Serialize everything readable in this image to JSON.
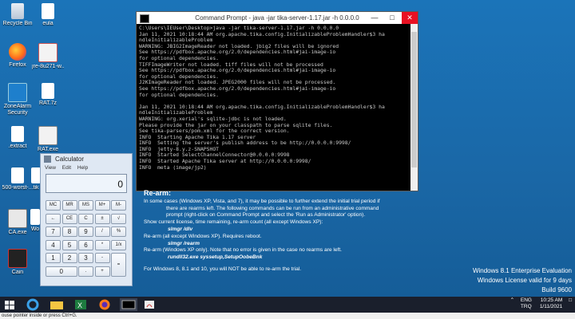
{
  "desktop_icons": [
    {
      "label": "Recycle Bin",
      "icon": "recycle-bin-icon"
    },
    {
      "label": "eula",
      "icon": "document-icon"
    },
    {
      "label": "Firefox",
      "icon": "firefox-icon"
    },
    {
      "label": "jre-8u271-w...",
      "icon": "java-installer-icon"
    },
    {
      "label": "ZoneAlarm Security",
      "icon": "zonealarm-icon"
    },
    {
      "label": "RAT.7z",
      "icon": "archive-icon"
    },
    {
      "label": ".extract",
      "icon": "folder-icon"
    },
    {
      "label": "RAT.exe",
      "icon": "exe-icon"
    },
    {
      "label": "500-worst-...",
      "icon": "document-icon"
    },
    {
      "label": "tik",
      "icon": "document-icon"
    },
    {
      "label": "CA.exe",
      "icon": "exe-icon"
    },
    {
      "label": "Wo",
      "icon": "document-icon"
    },
    {
      "label": "Cain",
      "icon": "cain-icon"
    }
  ],
  "cmd": {
    "title": "Command Prompt - java  -jar tika-server-1.17.jar -h 0.0.0.0",
    "lines": [
      "C:\\Users\\IEUser\\Desktop>java -jar tika-server-1.17.jar -h 0.0.0.0",
      "Jan 11, 2021 10:18:44 AM org.apache.tika.config.InitializableProblemHandler$3 ha",
      "ndleInitializableProblem",
      "WARNING: JBIG2ImageReader not loaded. jbig2 files will be ignored",
      "See https://pdfbox.apache.org/2.0/dependencies.html#jai-image-io",
      "for optional dependencies.",
      "TIFFImageWriter not loaded. tiff files will not be processed",
      "See https://pdfbox.apache.org/2.0/dependencies.html#jai-image-io",
      "for optional dependencies.",
      "J2KImageReader not loaded. JPEG2000 files will not be processed.",
      "See https://pdfbox.apache.org/2.0/dependencies.html#jai-image-io",
      "for optional dependencies.",
      "",
      "Jan 11, 2021 10:18:44 AM org.apache.tika.config.InitializableProblemHandler$3 ha",
      "ndleInitializableProblem",
      "WARNING: org.xerial's sqlite-jdbc is not loaded.",
      "Please provide the jar on your classpath to parse sqlite files.",
      "See tika-parsers/pom.xml for the correct version.",
      "INFO  Starting Apache Tika 1.17 server",
      "INFO  Setting the server's publish address to be http://0.0.0.0:9998/",
      "INFO  jetty-8.y.z-SNAPSHOT",
      "INFO  Started SelectChannelConnector@0.0.0.0:9998",
      "INFO  Started Apache Tika server at http://0.0.0.0:9998/",
      "INFO  meta (image/jp2)"
    ]
  },
  "page": {
    "heading": "Re-arm:",
    "p1a": "In some cases (Windows XP, Vista, and 7), it may be possible to further extend the initial trial period if",
    "p1b": "there are rearms left. The following commands can be run from an administrative command",
    "p1c": "prompt (right-click on Command Prompt and select the 'Run as Administrator' option).",
    "p2": "Show current license, time remaining, re-arm count (all except Windows XP):",
    "c1": "slmgr /dlv",
    "p3": "Re-arm (all except Windows XP). Requires reboot.",
    "c2": "slmgr /rearm",
    "p4": "Re-arm (Windows XP only). Note that no error is given in the case no rearms are left.",
    "c3": "rundll32.exe syssetup,SetupOobeBnk",
    "p5": "For Windows 8, 8.1 and 10, you will NOT be able to re-arm the trial."
  },
  "calculator": {
    "title": "Calculator",
    "menu": [
      "View",
      "Edit",
      "Help"
    ],
    "display": "0",
    "keys": [
      "MC",
      "MR",
      "MS",
      "M+",
      "M-",
      "←",
      "CE",
      "C",
      "±",
      "√",
      "7",
      "8",
      "9",
      "/",
      "%",
      "4",
      "5",
      "6",
      "*",
      "1/x",
      "1",
      "2",
      "3",
      "-",
      "=",
      "0",
      ".",
      "+"
    ]
  },
  "watermark": {
    "line1": "Windows 8.1 Enterprise Evaluation",
    "line2": "Windows License valid for 9 days",
    "line3": "Build 9600"
  },
  "taskbar": {
    "items": [
      "start-icon",
      "ie-icon",
      "file-explorer-icon",
      "excel-icon",
      "firefox-icon",
      "cmd-icon",
      "java-icon"
    ],
    "lang": "ENG",
    "layout": "TRQ",
    "time": "10:25 AM",
    "date": "1/11/2021"
  },
  "statusbar": "ouse pointer inside or press Ctrl+G.",
  "colors": {
    "desktop": "#1b74b9",
    "taskbar": "#1a1f2c",
    "console_bg": "#000000"
  }
}
